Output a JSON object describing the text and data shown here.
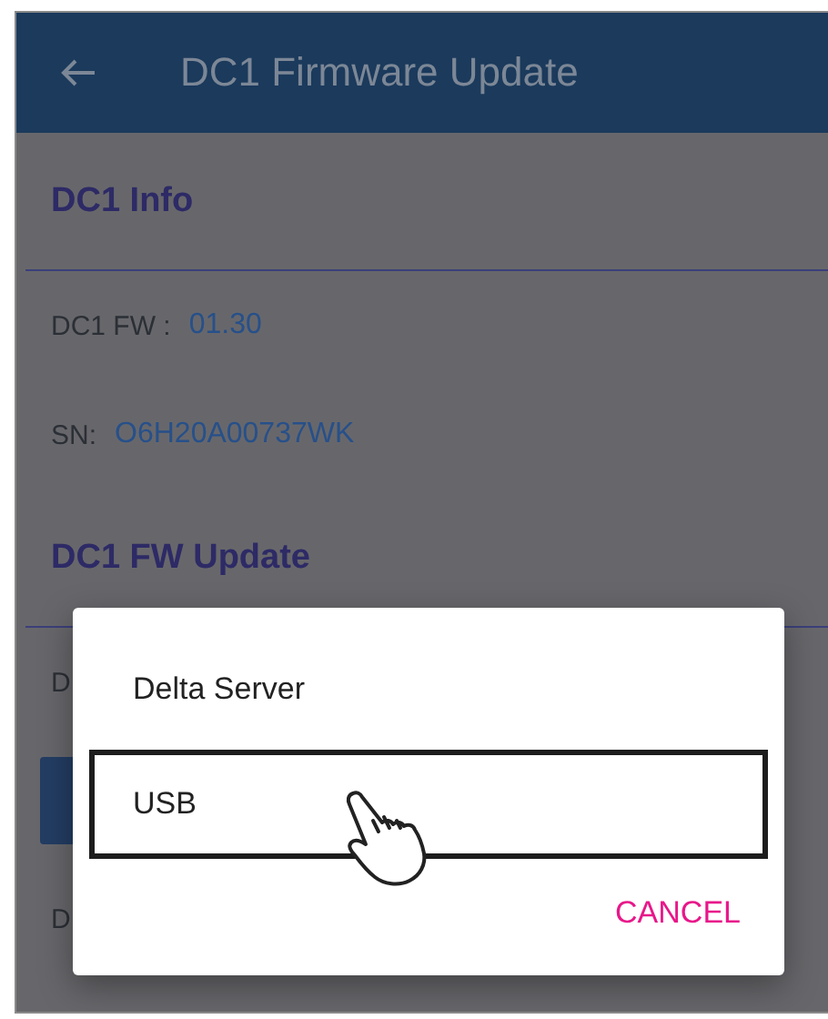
{
  "app_bar": {
    "title": "DC1 Firmware Update"
  },
  "sections": [
    {
      "heading": "DC1 Info",
      "rows": [
        {
          "kind": "field",
          "label": "DC1 FW :",
          "value": "01.30"
        },
        {
          "kind": "field",
          "label": "SN:",
          "value": "O6H20A00737WK"
        }
      ]
    },
    {
      "heading": "DC1 FW Update",
      "rows": [
        {
          "kind": "text",
          "label": "D"
        },
        {
          "kind": "button"
        },
        {
          "kind": "text",
          "label": "D"
        }
      ]
    }
  ],
  "dialog": {
    "options": [
      {
        "label": "Delta Server",
        "selected": false
      },
      {
        "label": "USB",
        "selected": true
      }
    ],
    "cancel": "CANCEL"
  }
}
